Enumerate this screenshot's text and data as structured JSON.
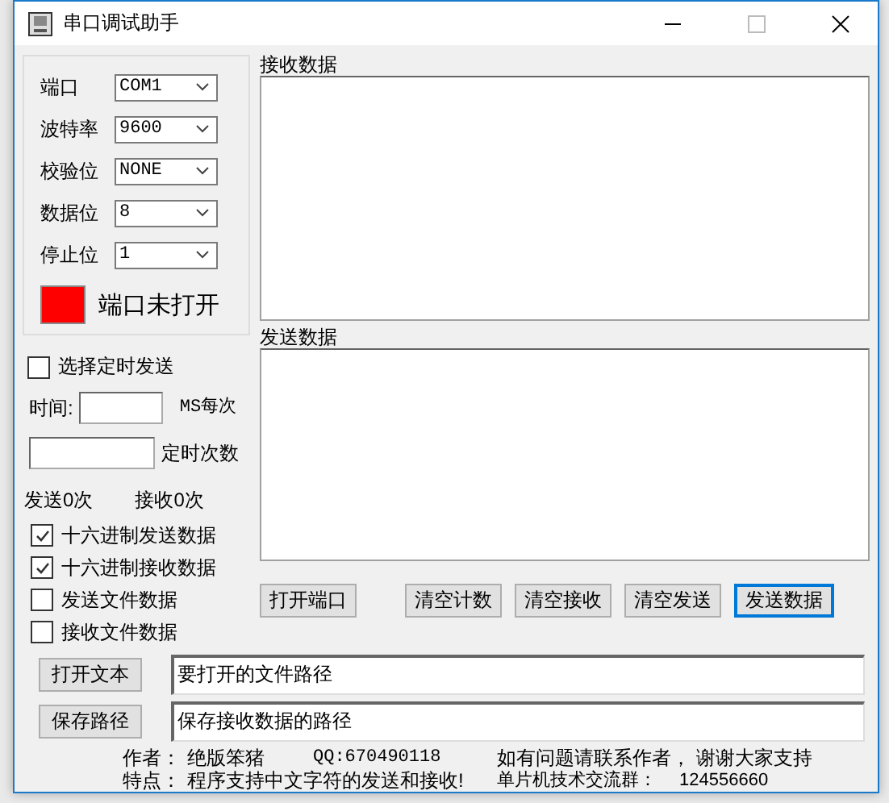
{
  "window": {
    "title": "串口调试助手"
  },
  "settings": [
    {
      "label": "端口",
      "value": "COM1"
    },
    {
      "label": "波特率",
      "value": "9600"
    },
    {
      "label": "校验位",
      "value": "NONE"
    },
    {
      "label": "数据位",
      "value": "8"
    },
    {
      "label": "停止位",
      "value": "1"
    }
  ],
  "port_status": {
    "color": "#ff0000",
    "text": "端口未打开"
  },
  "timed_send": {
    "label": "选择定时发送",
    "checked": false
  },
  "interval": {
    "label": "时间:",
    "unit": "MS每次"
  },
  "count": {
    "label": "定时次数"
  },
  "counters": [
    "发送0次",
    "接收0次"
  ],
  "options": [
    {
      "label": "十六进制发送数据",
      "checked": true
    },
    {
      "label": "十六进制接收数据",
      "checked": true
    },
    {
      "label": "发送文件数据",
      "checked": false
    },
    {
      "label": "接收文件数据",
      "checked": false
    }
  ],
  "receive": {
    "title": "接收数据"
  },
  "send": {
    "title": "发送数据"
  },
  "buttons": [
    {
      "label": "打开端口",
      "focused": false
    },
    {
      "label": "清空计数",
      "focused": false
    },
    {
      "label": "清空接收",
      "focused": false
    },
    {
      "label": "清空发送",
      "focused": false
    },
    {
      "label": "发送数据",
      "focused": true
    }
  ],
  "files": [
    {
      "button": "打开文本",
      "value": "要打开的文件路径"
    },
    {
      "button": "保存路径",
      "value": "保存接收数据的路径"
    }
  ],
  "footer": [
    [
      "作者：",
      "绝版笨猪",
      "QQ:670490118",
      "如有问题请联系作者， 谢谢大家支持"
    ],
    [
      "特点：",
      "程序支持中文字符的发送和接收!",
      "单片机技术交流群：",
      "124556660"
    ]
  ]
}
